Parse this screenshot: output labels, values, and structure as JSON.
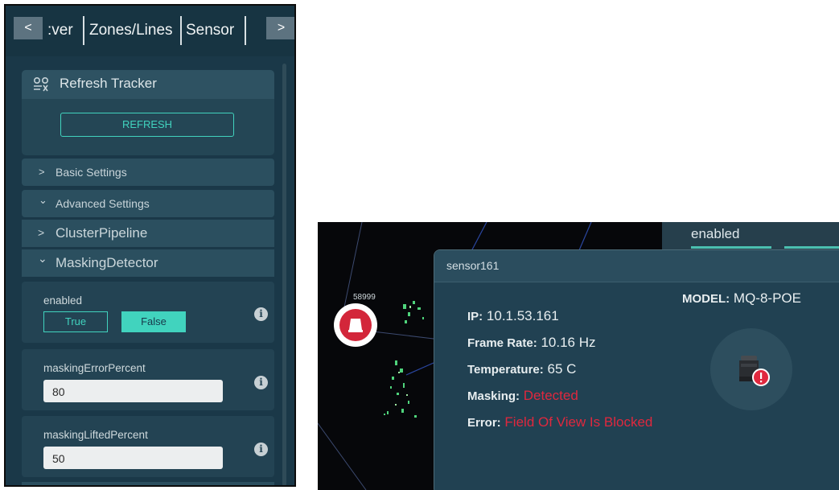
{
  "left_panel": {
    "tabs": [
      ":ver",
      "Zones/Lines",
      "Sensor"
    ],
    "scroll_left_glyph": "<",
    "scroll_right_glyph": ">",
    "refresh_tracker": {
      "title": "Refresh Tracker",
      "button": "REFRESH",
      "icon": "tracker-icon"
    },
    "sections": {
      "basic": "Basic Settings",
      "advanced": "Advanced Settings"
    },
    "subsections": {
      "cluster": "ClusterPipeline",
      "masking": "MaskingDetector"
    },
    "params": {
      "enabled": {
        "label": "enabled",
        "true_label": "True",
        "false_label": "False",
        "selected": "False"
      },
      "error": {
        "label": "maskingErrorPercent",
        "value": "80"
      },
      "lifted": {
        "label": "maskingLiftedPercent",
        "value": "50"
      }
    },
    "chevron_right": ">",
    "chevron_down": "⌄",
    "info_glyph": "i",
    "accent": "#41d3be"
  },
  "right_panel": {
    "header_enabled": "enabled",
    "map_point_label": "58999",
    "tooltip": {
      "name": "sensor161",
      "model_label": "MODEL:",
      "model_value": "MQ-8-POE",
      "ip_label": "IP:",
      "ip_value": "10.1.53.161",
      "frame_label": "Frame Rate:",
      "frame_value": "10.16 Hz",
      "temp_label": "Temperature:",
      "temp_value": "65 C",
      "masking_label": "Masking:",
      "masking_value": "Detected",
      "error_label": "Error:",
      "error_value": "Field Of View Is Blocked"
    },
    "alert_color": "#e0283e",
    "marker_icon": "sensor-marker-icon",
    "avatar_icon": "lidar-sensor-icon"
  }
}
